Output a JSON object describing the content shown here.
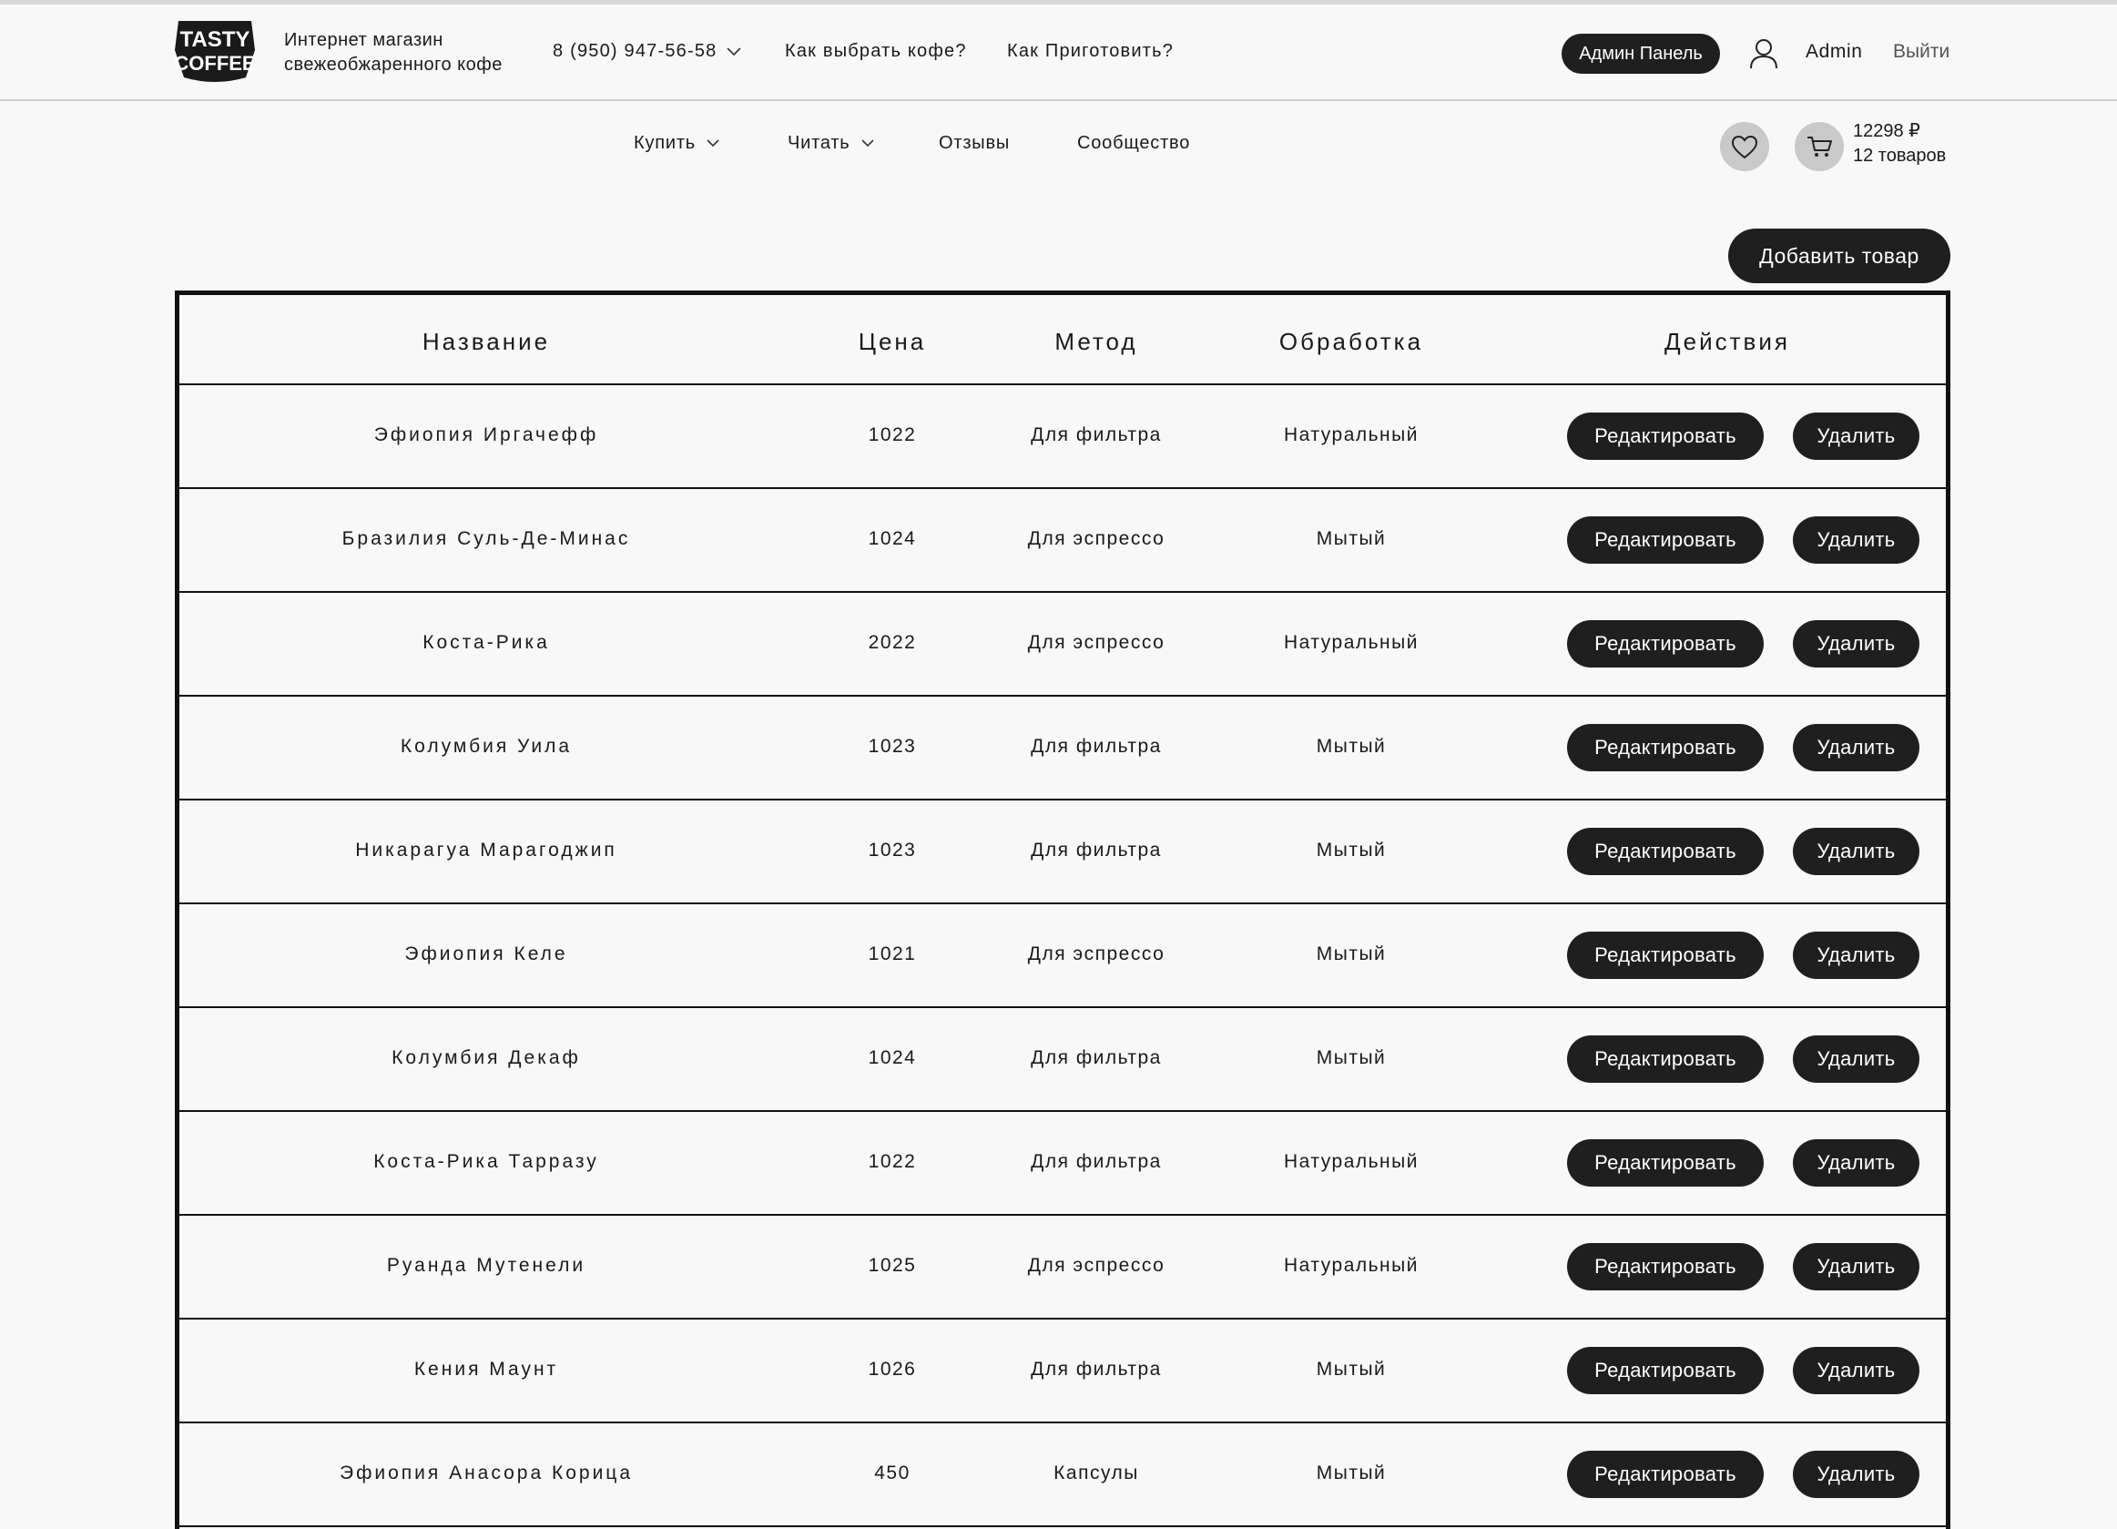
{
  "header": {
    "logo_text_line1": "TASTY",
    "logo_text_line2": "COFFEE",
    "tagline_line1": "Интернет магазин",
    "tagline_line2": "свежеобжаренного кофе",
    "phone": "8 (950) 947-56-58",
    "links": [
      "Как выбрать кофе?",
      "Как Приготовить?"
    ],
    "admin_panel_label": "Админ Панель",
    "username": "Admin",
    "logout_label": "Выйти"
  },
  "nav": {
    "items": [
      {
        "label": "Купить",
        "has_dropdown": true
      },
      {
        "label": "Читать",
        "has_dropdown": true
      },
      {
        "label": "Отзывы",
        "has_dropdown": false
      },
      {
        "label": "Сообщество",
        "has_dropdown": false
      }
    ],
    "favorites_icon": "heart-icon",
    "cart_icon": "cart-icon",
    "cart_total": "12298 ₽",
    "cart_count": "12 товаров"
  },
  "add_product_label": "Добавить товар",
  "table": {
    "headers": [
      "Название",
      "Цена",
      "Метод",
      "Обработка",
      "Действия"
    ],
    "edit_label": "Редактировать",
    "delete_label": "Удалить",
    "rows": [
      {
        "name": "Эфиопия Иргачефф",
        "price": "1022",
        "method": "Для фильтра",
        "processing": "Натуральный"
      },
      {
        "name": "Бразилия Суль-Де-Минас",
        "price": "1024",
        "method": "Для эспрессо",
        "processing": "Мытый"
      },
      {
        "name": "Коста-Рика",
        "price": "2022",
        "method": "Для эспрессо",
        "processing": "Натуральный"
      },
      {
        "name": "Колумбия Уила",
        "price": "1023",
        "method": "Для фильтра",
        "processing": "Мытый"
      },
      {
        "name": "Никарагуа Марагоджип",
        "price": "1023",
        "method": "Для фильтра",
        "processing": "Мытый"
      },
      {
        "name": "Эфиопия Келе",
        "price": "1021",
        "method": "Для эспрессо",
        "processing": "Мытый"
      },
      {
        "name": "Колумбия Декаф",
        "price": "1024",
        "method": "Для фильтра",
        "processing": "Мытый"
      },
      {
        "name": "Коста-Рика Тарразу",
        "price": "1022",
        "method": "Для фильтра",
        "processing": "Натуральный"
      },
      {
        "name": "Руанда Мутенели",
        "price": "1025",
        "method": "Для эспрессо",
        "processing": "Натуральный"
      },
      {
        "name": "Кения Маунт",
        "price": "1026",
        "method": "Для фильтра",
        "processing": "Мытый"
      },
      {
        "name": "Эфиопия Анасора Корица",
        "price": "450",
        "method": "Капсулы",
        "processing": "Мытый"
      }
    ]
  }
}
